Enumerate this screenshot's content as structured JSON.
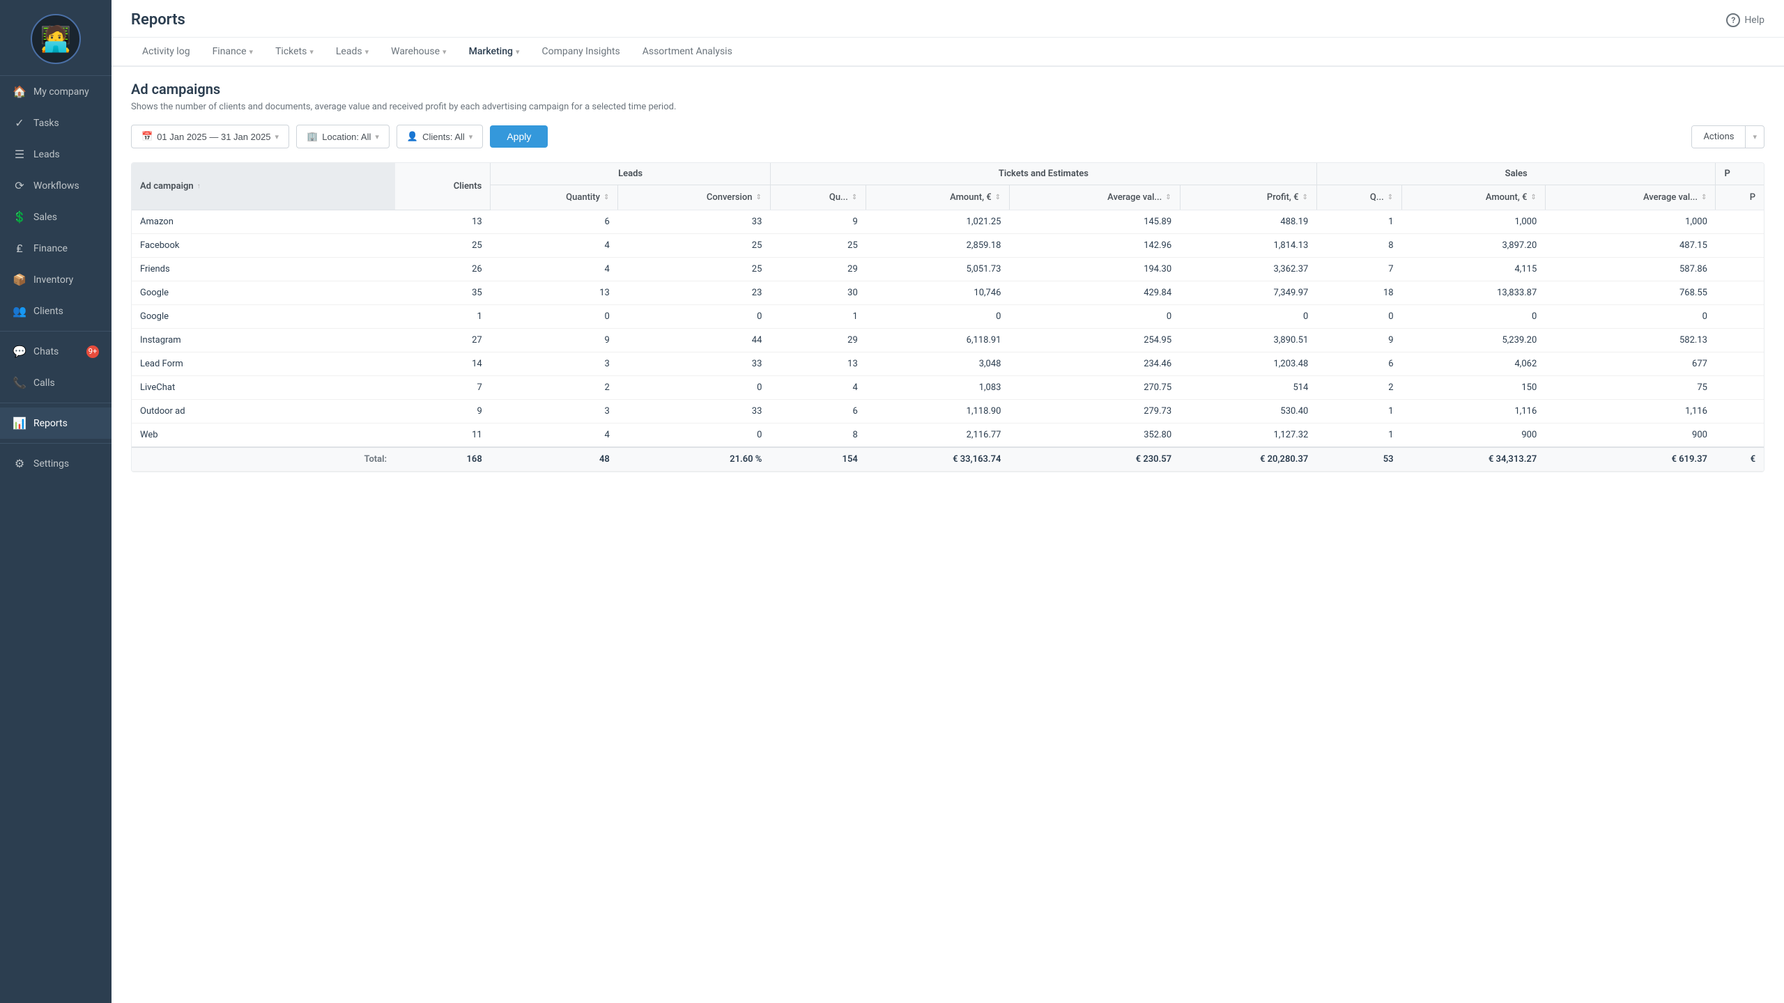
{
  "sidebar": {
    "items": [
      {
        "id": "my-company",
        "label": "My company",
        "icon": "🏠"
      },
      {
        "id": "tasks",
        "label": "Tasks",
        "icon": "✓"
      },
      {
        "id": "leads",
        "label": "Leads",
        "icon": "≡"
      },
      {
        "id": "workflows",
        "label": "Workflows",
        "icon": "⟳"
      },
      {
        "id": "sales",
        "label": "Sales",
        "icon": "💲"
      },
      {
        "id": "finance",
        "label": "Finance",
        "icon": "₤"
      },
      {
        "id": "inventory",
        "label": "Inventory",
        "icon": "📦"
      },
      {
        "id": "clients",
        "label": "Clients",
        "icon": "👥"
      },
      {
        "id": "chats",
        "label": "Chats",
        "icon": "💬",
        "badge": "9+"
      },
      {
        "id": "calls",
        "label": "Calls",
        "icon": "📞"
      },
      {
        "id": "reports",
        "label": "Reports",
        "icon": "📊",
        "active": true
      },
      {
        "id": "settings",
        "label": "Settings",
        "icon": "⚙"
      }
    ]
  },
  "header": {
    "title": "Reports",
    "help_label": "Help"
  },
  "tabs": [
    {
      "id": "activity-log",
      "label": "Activity log",
      "has_arrow": false
    },
    {
      "id": "finance",
      "label": "Finance",
      "has_arrow": true
    },
    {
      "id": "tickets",
      "label": "Tickets",
      "has_arrow": true
    },
    {
      "id": "leads",
      "label": "Leads",
      "has_arrow": true
    },
    {
      "id": "warehouse",
      "label": "Warehouse",
      "has_arrow": true
    },
    {
      "id": "marketing",
      "label": "Marketing",
      "has_arrow": true,
      "active": true
    },
    {
      "id": "company-insights",
      "label": "Company Insights",
      "has_arrow": false
    },
    {
      "id": "assortment-analysis",
      "label": "Assortment Analysis",
      "has_arrow": false
    }
  ],
  "section": {
    "title": "Ad campaigns",
    "description": "Shows the number of clients and documents, average value and received profit by each advertising campaign for a selected time period."
  },
  "filters": {
    "date_range": "01 Jan 2025 — 31 Jan 2025",
    "location": "Location: All",
    "clients": "Clients: All",
    "apply_label": "Apply",
    "actions_label": "Actions"
  },
  "table": {
    "group_headers": [
      {
        "label": "Ad campaign",
        "colspan": 1
      },
      {
        "label": "Clients",
        "colspan": 1
      },
      {
        "label": "Leads",
        "colspan": 2
      },
      {
        "label": "Tickets and Estimates",
        "colspan": 4
      },
      {
        "label": "Sales",
        "colspan": 3
      }
    ],
    "sub_headers": [
      {
        "label": "Ad campaign",
        "sortable": true
      },
      {
        "label": "Clients"
      },
      {
        "label": "Quantity"
      },
      {
        "label": "Conversion"
      },
      {
        "label": "Qu...",
        "sortable": true
      },
      {
        "label": "Amount, €",
        "sortable": true
      },
      {
        "label": "Average val...",
        "sortable": true
      },
      {
        "label": "Profit, €",
        "sortable": true
      },
      {
        "label": "Q...",
        "sortable": true
      },
      {
        "label": "Amount, €",
        "sortable": true
      },
      {
        "label": "Average val...",
        "sortable": true
      },
      {
        "label": "P"
      }
    ],
    "rows": [
      {
        "campaign": "Amazon",
        "clients": 13,
        "leads_qty": 6,
        "leads_conv": 33,
        "te_qu": 9,
        "te_amount": "1,021.25",
        "te_avg": "145.89",
        "te_profit": "488.19",
        "sales_q": 1,
        "sales_amount": "1,000",
        "sales_avg": "1,000",
        "p": ""
      },
      {
        "campaign": "Facebook",
        "clients": 25,
        "leads_qty": 4,
        "leads_conv": 25,
        "te_qu": 25,
        "te_amount": "2,859.18",
        "te_avg": "142.96",
        "te_profit": "1,814.13",
        "sales_q": 8,
        "sales_amount": "3,897.20",
        "sales_avg": "487.15",
        "p": ""
      },
      {
        "campaign": "Friends",
        "clients": 26,
        "leads_qty": 4,
        "leads_conv": 25,
        "te_qu": 29,
        "te_amount": "5,051.73",
        "te_avg": "194.30",
        "te_profit": "3,362.37",
        "sales_q": 7,
        "sales_amount": "4,115",
        "sales_avg": "587.86",
        "p": ""
      },
      {
        "campaign": "Google",
        "clients": 35,
        "leads_qty": 13,
        "leads_conv": 23,
        "te_qu": 30,
        "te_amount": "10,746",
        "te_avg": "429.84",
        "te_profit": "7,349.97",
        "sales_q": 18,
        "sales_amount": "13,833.87",
        "sales_avg": "768.55",
        "p": ""
      },
      {
        "campaign": "Google",
        "clients": 1,
        "leads_qty": 0,
        "leads_conv": 0,
        "te_qu": 1,
        "te_amount": "0",
        "te_avg": "0",
        "te_profit": "0",
        "sales_q": 0,
        "sales_amount": "0",
        "sales_avg": "0",
        "p": ""
      },
      {
        "campaign": "Instagram",
        "clients": 27,
        "leads_qty": 9,
        "leads_conv": 44,
        "te_qu": 29,
        "te_amount": "6,118.91",
        "te_avg": "254.95",
        "te_profit": "3,890.51",
        "sales_q": 9,
        "sales_amount": "5,239.20",
        "sales_avg": "582.13",
        "p": ""
      },
      {
        "campaign": "Lead Form",
        "clients": 14,
        "leads_qty": 3,
        "leads_conv": 33,
        "te_qu": 13,
        "te_amount": "3,048",
        "te_avg": "234.46",
        "te_profit": "1,203.48",
        "sales_q": 6,
        "sales_amount": "4,062",
        "sales_avg": "677",
        "p": ""
      },
      {
        "campaign": "LiveChat",
        "clients": 7,
        "leads_qty": 2,
        "leads_conv": 0,
        "te_qu": 4,
        "te_amount": "1,083",
        "te_avg": "270.75",
        "te_profit": "514",
        "sales_q": 2,
        "sales_amount": "150",
        "sales_avg": "75",
        "p": ""
      },
      {
        "campaign": "Outdoor ad",
        "clients": 9,
        "leads_qty": 3,
        "leads_conv": 33,
        "te_qu": 6,
        "te_amount": "1,118.90",
        "te_avg": "279.73",
        "te_profit": "530.40",
        "sales_q": 1,
        "sales_amount": "1,116",
        "sales_avg": "1,116",
        "p": ""
      },
      {
        "campaign": "Web",
        "clients": 11,
        "leads_qty": 4,
        "leads_conv": 0,
        "te_qu": 8,
        "te_amount": "2,116.77",
        "te_avg": "352.80",
        "te_profit": "1,127.32",
        "sales_q": 1,
        "sales_amount": "900",
        "sales_avg": "900",
        "p": ""
      }
    ],
    "totals": {
      "label": "Total:",
      "clients": "168",
      "leads_qty": "48",
      "leads_conv": "21.60 %",
      "te_qu": "154",
      "te_amount": "€ 33,163.74",
      "te_avg": "€ 230.57",
      "te_profit": "€ 20,280.37",
      "sales_q": "53",
      "sales_amount": "€ 34,313.27",
      "sales_avg": "€ 619.37",
      "p": "€"
    }
  }
}
